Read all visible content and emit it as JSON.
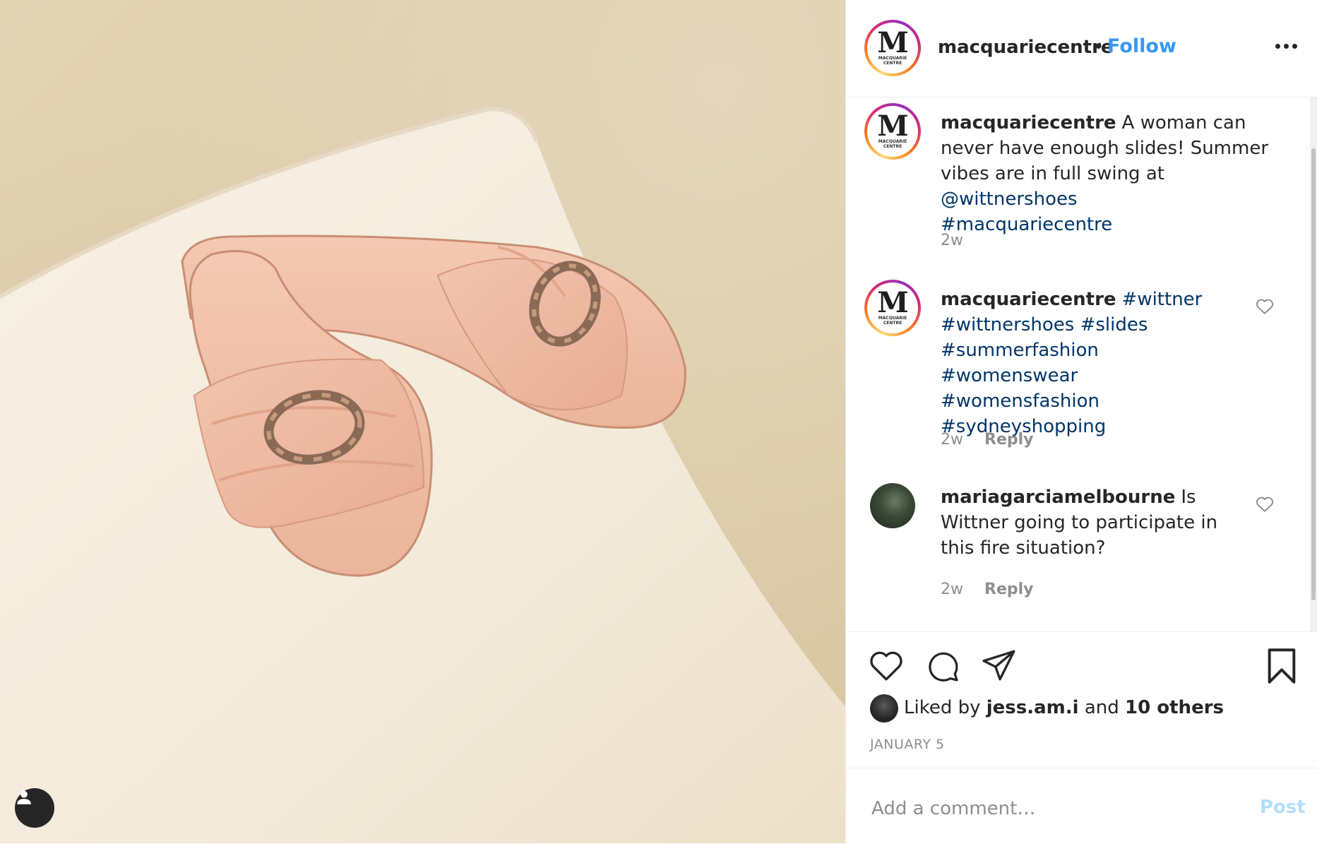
{
  "post": {
    "image_alt": "Pink slide sandals with tortoiseshell buckles on a cream cushion",
    "user_tag_icon": "person-icon"
  },
  "header": {
    "avatar_logo_letter": "M",
    "avatar_logo_sub": "MACQUARIE CENTRE",
    "username": "macquariecentre",
    "separator": "•",
    "follow_label": "Follow",
    "more_icon": "more-horizontal-icon"
  },
  "caption": {
    "username": "macquariecentre",
    "text": "A woman can never have enough slides! Summer vibes are in full swing at ",
    "mention": "@wittnershoes",
    "hashtag": "#macquariecentre",
    "time": "2w"
  },
  "comments": [
    {
      "username": "macquariecentre",
      "hashtags": [
        "#wittner",
        "#wittnershoes",
        "#slides",
        "#summerfashion",
        "#womenswear",
        "#womensfashion",
        "#sydneyshopping"
      ],
      "time": "2w",
      "reply_label": "Reply"
    },
    {
      "username": "mariagarciamelbourne",
      "text": "Is Wittner going to participate in this fire situation?",
      "time": "2w",
      "reply_label": "Reply"
    }
  ],
  "actions": {
    "like_icon": "heart-icon",
    "comment_icon": "comment-icon",
    "share_icon": "send-icon",
    "save_icon": "bookmark-icon",
    "liked_by_prefix": "Liked by",
    "liked_by_user": "jess.am.i",
    "liked_by_and": "and",
    "liked_by_others": "10 others",
    "date": "JANUARY 5"
  },
  "add_comment": {
    "placeholder": "Add a comment…",
    "post_label": "Post"
  },
  "colors": {
    "link_blue": "#3897f0",
    "hashtag_blue": "#003569",
    "muted_gray": "#8e8e8e",
    "post_disabled": "#b2dffc"
  }
}
